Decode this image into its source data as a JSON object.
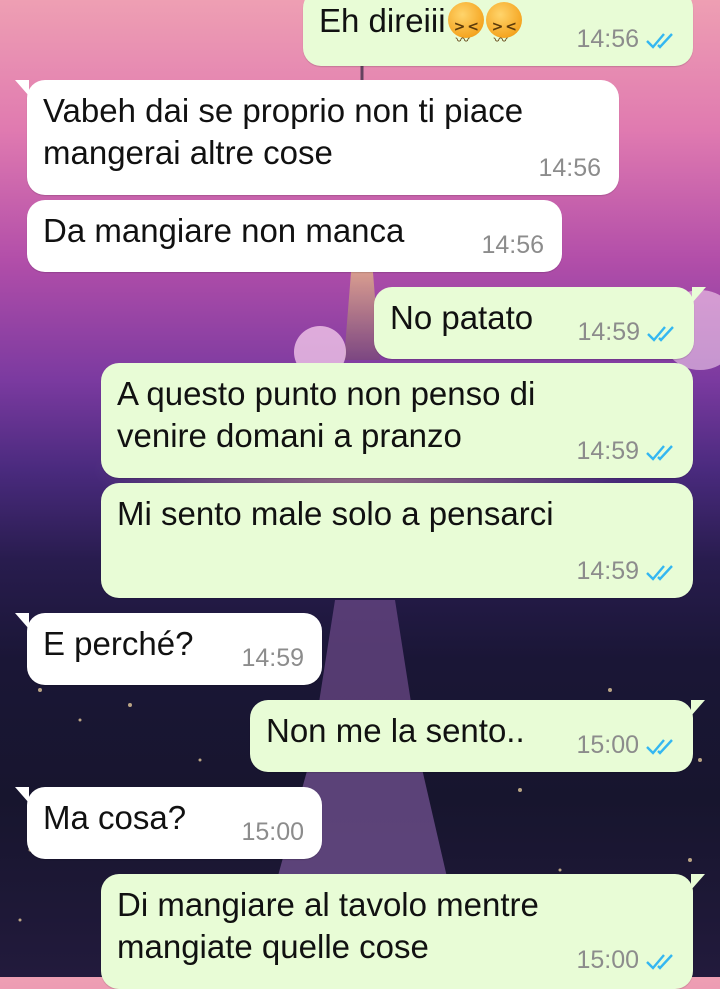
{
  "messages": [
    {
      "side": "out",
      "text": "Eh direiii",
      "emoji": "confounded-face-icon x2",
      "time": "14:56",
      "status": "read"
    },
    {
      "side": "in",
      "text": "Vabeh dai se proprio non ti piace\nmangerai altre cose",
      "time": "14:56"
    },
    {
      "side": "in",
      "text": "Da mangiare non manca",
      "time": "14:56"
    },
    {
      "side": "out",
      "text": "No patato",
      "time": "14:59",
      "status": "read"
    },
    {
      "side": "out",
      "text": "A questo punto non penso di\nvenire domani a pranzo",
      "time": "14:59",
      "status": "read"
    },
    {
      "side": "out",
      "text": "Mi sento male solo a pensarci",
      "time": "14:59",
      "status": "read"
    },
    {
      "side": "in",
      "text": "E perché?",
      "time": "14:59"
    },
    {
      "side": "out",
      "text": "Non me la sento..",
      "time": "15:00",
      "status": "read"
    },
    {
      "side": "in",
      "text": "Ma cosa?",
      "time": "15:00"
    },
    {
      "side": "out",
      "text": "Di mangiare al tavolo mentre\nmangiate quelle cose",
      "time": "15:00",
      "status": "read"
    }
  ],
  "colors": {
    "incoming_bubble": "#ffffff",
    "outgoing_bubble": "#e8fcd6",
    "read_ticks": "#34b7f1",
    "timestamp": "#8c8c8c"
  }
}
